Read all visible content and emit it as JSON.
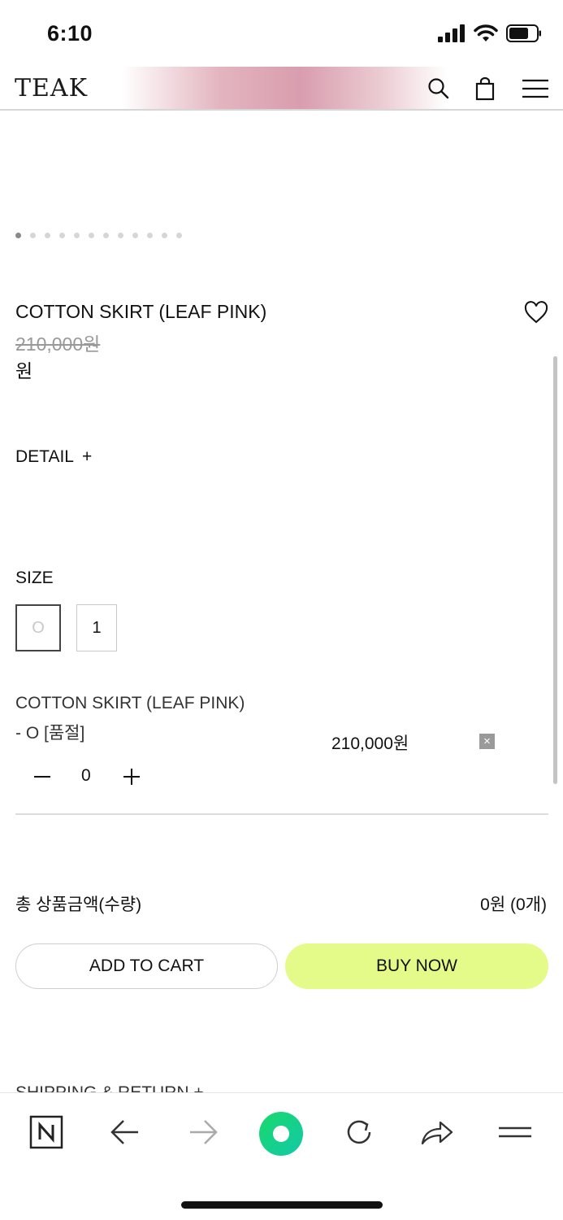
{
  "status": {
    "time": "6:10"
  },
  "header": {
    "logo": "TEAK",
    "icons": [
      "search-icon",
      "shopping-bag-icon",
      "menu-icon"
    ]
  },
  "carousel": {
    "total_dots": 12,
    "active_index": 0
  },
  "product": {
    "title": "COTTON SKIRT (LEAF PINK)",
    "original_price": "210,000원",
    "sale_price": "원",
    "detail_label": "DETAIL",
    "detail_toggle": "+"
  },
  "size": {
    "label": "SIZE",
    "options": [
      "O",
      "1"
    ],
    "selected": "O"
  },
  "selected_option": {
    "name": "COTTON SKIRT (LEAF PINK)",
    "variant": "- O [품절]",
    "price": "210,000원",
    "remove": "×",
    "quantity": "0",
    "minus": "minus-icon",
    "plus": "plus-icon"
  },
  "total": {
    "label": "총 상품금액(수량)",
    "value": "0원 (0개)"
  },
  "buttons": {
    "add_to_cart": "ADD TO CART",
    "buy_now": "BUY NOW",
    "buy_now_color": "#e4fb8a"
  },
  "next_section": {
    "label": "SHIPPING & RETURN +"
  },
  "browser_toolbar": {
    "icons": [
      "naver-n-icon",
      "back-arrow-icon",
      "forward-arrow-icon",
      "green-circle-icon",
      "reload-icon",
      "share-icon",
      "menu-icon"
    ]
  }
}
